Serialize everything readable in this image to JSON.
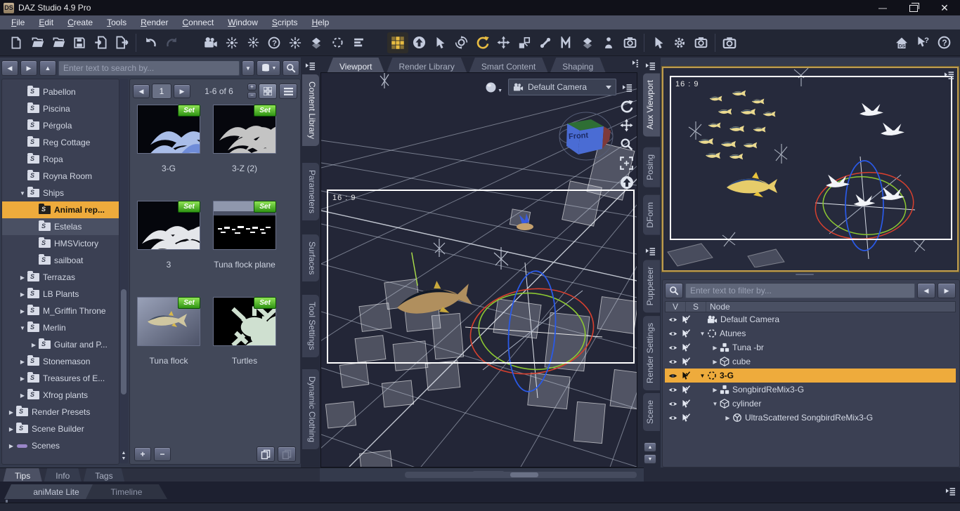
{
  "window": {
    "title": "DAZ Studio 4.9 Pro",
    "logo": "DS"
  },
  "menu": {
    "items": [
      "File",
      "Edit",
      "Create",
      "Tools",
      "Render",
      "Connect",
      "Window",
      "Scripts",
      "Help"
    ]
  },
  "toolbar": {
    "icons": [
      "new-file",
      "open-file",
      "merge-file",
      "save-file",
      "import-file",
      "export-file",
      "undo",
      "redo",
      "create-camera",
      "create-distant-light",
      "create-point-light",
      "create-linear-point-light",
      "create-spotlight",
      "create-dform",
      "create-null",
      "create-primitive",
      "content-gallery",
      "viewport-navigation",
      "node-selection",
      "orbit-selection",
      "rotate-tool",
      "translate-tool",
      "scale-tool",
      "joint-editor",
      "surface-selection",
      "geometry-editor",
      "figure-selection",
      "camera-selection",
      "tool-settings",
      "lights-settings",
      "render-settings",
      "render",
      "daz-home",
      "whats-this-help",
      "help"
    ],
    "active_tool": "rotate-tool",
    "highlighted": "content-gallery"
  },
  "content_library": {
    "search_placeholder": "Enter text to search by...",
    "tree": {
      "items": [
        {
          "label": "Pabellon"
        },
        {
          "label": "Piscina"
        },
        {
          "label": "Pérgola"
        },
        {
          "label": "Reg Cottage"
        },
        {
          "label": "Ropa"
        },
        {
          "label": "Royna Room"
        },
        {
          "label": "Ships",
          "expanded": true
        },
        {
          "label": "Animal rep...",
          "selected": true
        },
        {
          "label": "Estelas"
        },
        {
          "label": "HMSVictory"
        },
        {
          "label": "sailboat"
        },
        {
          "label": "Terrazas"
        },
        {
          "label": "LB Plants"
        },
        {
          "label": "M_Griffin Throne"
        },
        {
          "label": "Merlin",
          "expanded": true
        },
        {
          "label": "Guitar and P..."
        },
        {
          "label": "Stonemason"
        },
        {
          "label": "Treasures of E..."
        },
        {
          "label": "Xfrog plants"
        },
        {
          "label": "Render Presets"
        },
        {
          "label": "Scene Builder"
        },
        {
          "label": "Scenes"
        }
      ]
    },
    "pager": {
      "page": "1",
      "range": "1-6 of 6"
    },
    "thumbs": [
      {
        "label": "3-G",
        "badge": "Set"
      },
      {
        "label": "3-Z (2)",
        "badge": "Set"
      },
      {
        "label": "3",
        "badge": "Set"
      },
      {
        "label": "Tuna flock plane",
        "badge": "Set"
      },
      {
        "label": "Tuna flock",
        "badge": "Set"
      },
      {
        "label": "Turtles",
        "badge": "Set"
      }
    ],
    "bottom_tabs": [
      "Tips",
      "Info",
      "Tags"
    ]
  },
  "left_tabs": [
    "Content Library",
    "Parameters",
    "Surfaces",
    "Tool Settings",
    "Dynamic Clothing"
  ],
  "viewport": {
    "tabs": [
      "Viewport",
      "Render Library",
      "Smart Content",
      "Shaping"
    ],
    "active_tab": "Viewport",
    "camera_selector": "Default Camera",
    "aspect_label": "16 : 9",
    "view_cube_label": "Front"
  },
  "right_tabs": {
    "group1": [
      "Aux Viewport",
      "Posing",
      "DForm"
    ],
    "group2": [
      "Puppeteer",
      "Render Settings",
      "Scene"
    ],
    "active": "Aux Viewport"
  },
  "aux_viewport": {
    "aspect_label": "16 : 9"
  },
  "scene_panel": {
    "filter_placeholder": "Enter text to filter by...",
    "columns": [
      "V",
      "S",
      "Node"
    ],
    "nodes": [
      {
        "label": "Default Camera",
        "icon": "camera"
      },
      {
        "label": "Atunes",
        "icon": "null",
        "expanded": true
      },
      {
        "label": "Tuna -br",
        "icon": "group"
      },
      {
        "label": "cube",
        "icon": "cube"
      },
      {
        "label": "3-G",
        "icon": "null",
        "expanded": true,
        "selected": true
      },
      {
        "label": "SongbirdReMix3-G",
        "icon": "group"
      },
      {
        "label": "cylinder",
        "icon": "cube",
        "expanded": true
      },
      {
        "label": "UltraScattered SongbirdReMix3-G",
        "icon": "scatter"
      }
    ]
  },
  "bottom_bar": {
    "tabs": [
      "aniMate Lite",
      "Timeline"
    ]
  },
  "colors": {
    "selection": "#eeab3c",
    "badge_green": "#3fae1c",
    "aux_border": "#bd9c50",
    "accent_yellow": "#e8bc42"
  }
}
